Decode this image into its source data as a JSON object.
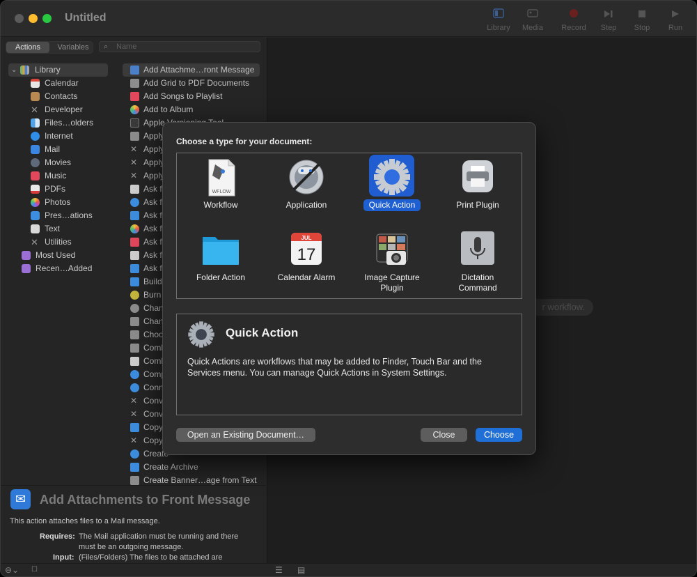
{
  "window": {
    "title": "Untitled",
    "toolbar": [
      {
        "label": "Library",
        "icon": "library-icon"
      },
      {
        "label": "Media",
        "icon": "media-icon"
      },
      {
        "label": "Record",
        "icon": "record-icon"
      },
      {
        "label": "Step",
        "icon": "step-icon"
      },
      {
        "label": "Stop",
        "icon": "stop-icon"
      },
      {
        "label": "Run",
        "icon": "run-icon"
      }
    ]
  },
  "sidebar": {
    "tabs": {
      "actions": "Actions",
      "variables": "Variables"
    },
    "search_placeholder": "Name",
    "library": [
      {
        "label": "Library",
        "icon": "library-folder-icon"
      },
      {
        "label": "Calendar",
        "icon": "calendar-icon"
      },
      {
        "label": "Contacts",
        "icon": "contacts-icon"
      },
      {
        "label": "Developer",
        "icon": "developer-icon"
      },
      {
        "label": "Files…olders",
        "icon": "finder-icon"
      },
      {
        "label": "Internet",
        "icon": "internet-icon"
      },
      {
        "label": "Mail",
        "icon": "mail-icon"
      },
      {
        "label": "Movies",
        "icon": "movies-icon"
      },
      {
        "label": "Music",
        "icon": "music-icon"
      },
      {
        "label": "PDFs",
        "icon": "pdf-icon"
      },
      {
        "label": "Photos",
        "icon": "photos-icon"
      },
      {
        "label": "Pres…ations",
        "icon": "presentations-icon"
      },
      {
        "label": "Text",
        "icon": "text-icon"
      },
      {
        "label": "Utilities",
        "icon": "utilities-icon"
      },
      {
        "label": "Most Used",
        "icon": "most-used-folder-icon"
      },
      {
        "label": "Recen…Added",
        "icon": "recently-added-folder-icon"
      }
    ],
    "actions": [
      "Add Attachme…ront Message",
      "Add Grid to PDF Documents",
      "Add Songs to Playlist",
      "Add to Album",
      "Apple Versioning Tool",
      "Apply",
      "Apply",
      "Apply",
      "Apply",
      "Ask f",
      "Ask f",
      "Ask f",
      "Ask f",
      "Ask f",
      "Ask f",
      "Ask f",
      "Build",
      "Burn",
      "Chan",
      "Chan",
      "Choo",
      "Comb",
      "Comb",
      "Comp",
      "Conn",
      "Conv",
      "Conv",
      "Copy",
      "Copy",
      "Create",
      "Create Archive",
      "Create Banner…age from Text"
    ],
    "description": {
      "title": "Add Attachments to Front Message",
      "summary": "This action attaches files to a Mail message.",
      "requires_label": "Requires:",
      "requires_text_1": "The Mail application must be running and there",
      "requires_text_2": "must be an outgoing message.",
      "input_label": "Input:",
      "input_text": "(Files/Folders) The files to be attached are"
    }
  },
  "workarea": {
    "hint": "r workflow."
  },
  "dialog": {
    "prompt": "Choose a type for your document:",
    "types": [
      {
        "label": "Workflow",
        "icon": "workflow-document-icon",
        "badge": "WFLOW"
      },
      {
        "label": "Application",
        "icon": "automator-robot-icon"
      },
      {
        "label": "Quick Action",
        "icon": "gear-icon",
        "selected": true
      },
      {
        "label": "Print Plugin",
        "icon": "printer-icon"
      },
      {
        "label": "Folder Action",
        "icon": "folder-icon"
      },
      {
        "label": "Calendar Alarm",
        "icon": "calendar-alarm-icon",
        "month": "JUL",
        "day": "17"
      },
      {
        "label_line1": "Image Capture",
        "label_line2": "Plugin",
        "icon": "image-capture-icon"
      },
      {
        "label_line1": "Dictation",
        "label_line2": "Command",
        "icon": "microphone-icon"
      }
    ],
    "info": {
      "title": "Quick Action",
      "text": "Quick Actions are workflows that may be added to Finder, Touch Bar and the Services menu. You can manage Quick Actions in System Settings."
    },
    "buttons": {
      "open_existing": "Open an Existing Document…",
      "close": "Close",
      "choose": "Choose"
    }
  },
  "colors": {
    "accent": "#1f6fd6",
    "window_bg": "#262626",
    "sheet_bg": "#2d2d2d"
  }
}
